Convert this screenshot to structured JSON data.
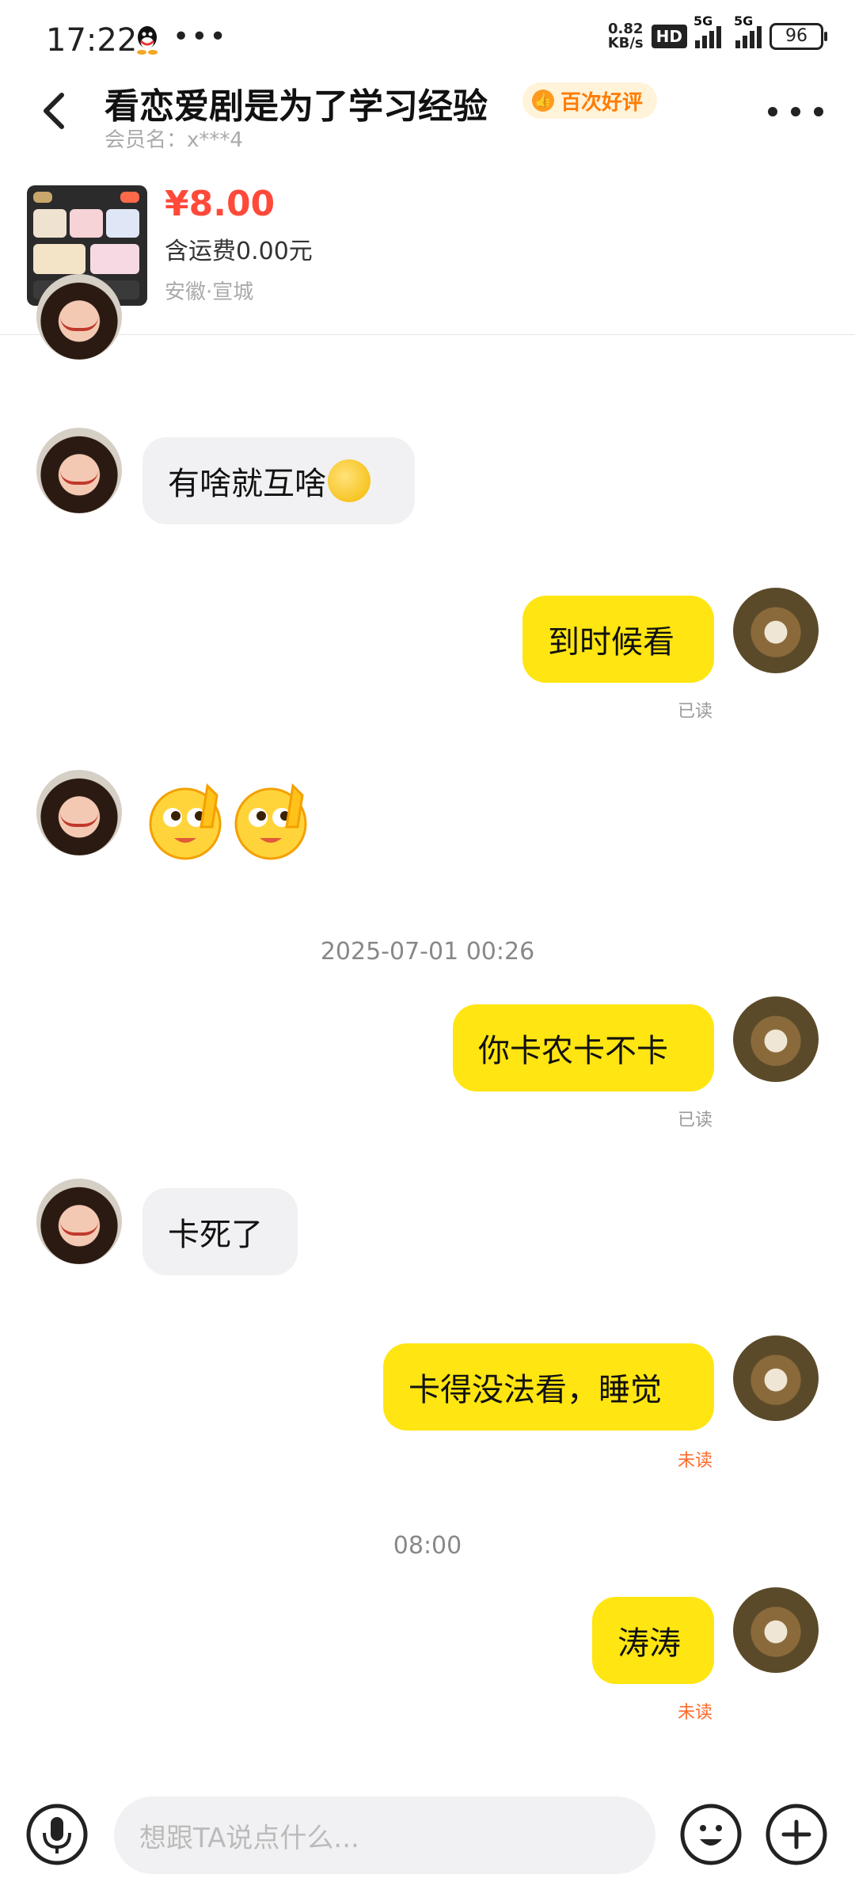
{
  "status": {
    "time": "17:22",
    "net_speed": "0.82",
    "net_unit": "KB/s",
    "hd": "HD",
    "sig1": "5G",
    "sig2": "5G",
    "battery": "96"
  },
  "header": {
    "title": "看恋爱剧是为了学习经验",
    "badge": "百次好评",
    "subtitle": "会员名：x***4"
  },
  "product": {
    "price": "¥8.00",
    "shipping": "含运费0.00元",
    "location": "安徽·宣城"
  },
  "messages": [
    {
      "side": "left",
      "text": "有啥就互啥"
    },
    {
      "side": "right",
      "text": "到时候看",
      "status": "已读"
    },
    {
      "side": "left",
      "emoji": "peek-emoji"
    },
    {
      "side": "right",
      "text": "你卡农卡不卡",
      "status": "已读"
    },
    {
      "side": "left",
      "text": "卡死了"
    },
    {
      "side": "right",
      "text": "卡得没法看，睡觉",
      "status": "未读"
    },
    {
      "side": "right",
      "text": "涛涛",
      "status": "未读"
    }
  ],
  "timestamps": [
    "2025-07-01 00:26",
    "08:00"
  ],
  "input": {
    "placeholder": "想跟TA说点什么..."
  },
  "colors": {
    "accent": "#ffe511",
    "price": "#ff4a3a",
    "unread": "#ff6a2a",
    "badge": "#ff7b00"
  }
}
